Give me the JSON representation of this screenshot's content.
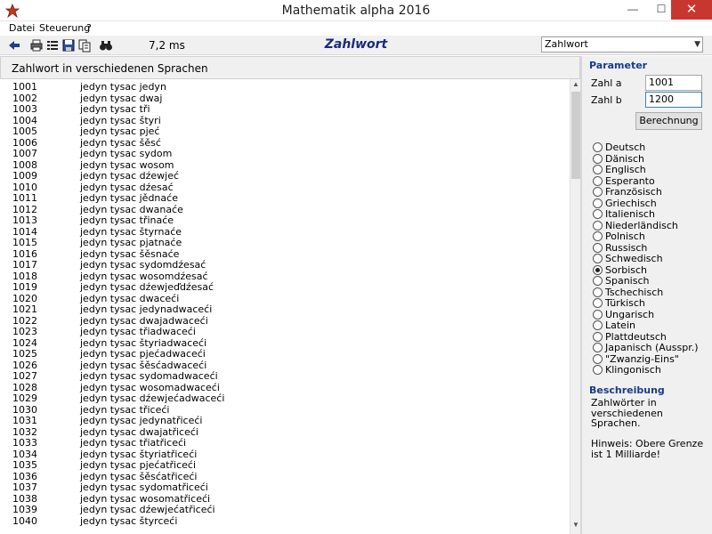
{
  "window": {
    "title": "Mathematik alpha 2016"
  },
  "menu": [
    {
      "label": "Datei",
      "accel": "D"
    },
    {
      "label": "Steuerung",
      "accel": "S"
    },
    {
      "label": "?"
    }
  ],
  "toolbar": {
    "timing": "7,2 ms",
    "title": "Zahlwort",
    "select_value": "Zahlwort"
  },
  "main": {
    "header": "Zahlwort in verschiedenen Sprachen",
    "rows": [
      {
        "num": "1001",
        "word": "jedyn tysac jedyn"
      },
      {
        "num": "1002",
        "word": "jedyn tysac dwaj"
      },
      {
        "num": "1003",
        "word": "jedyn tysac tři"
      },
      {
        "num": "1004",
        "word": "jedyn tysac štyri"
      },
      {
        "num": "1005",
        "word": "jedyn tysac pjeć"
      },
      {
        "num": "1006",
        "word": "jedyn tysac šěsć"
      },
      {
        "num": "1007",
        "word": "jedyn tysac sydom"
      },
      {
        "num": "1008",
        "word": "jedyn tysac wosom"
      },
      {
        "num": "1009",
        "word": "jedyn tysac dźewjeć"
      },
      {
        "num": "1010",
        "word": "jedyn tysac dźesać"
      },
      {
        "num": "1011",
        "word": "jedyn tysac jědnaće"
      },
      {
        "num": "1012",
        "word": "jedyn tysac dwanaće"
      },
      {
        "num": "1013",
        "word": "jedyn tysac třinaće"
      },
      {
        "num": "1014",
        "word": "jedyn tysac štyrnaće"
      },
      {
        "num": "1015",
        "word": "jedyn tysac pjatnaće"
      },
      {
        "num": "1016",
        "word": "jedyn tysac šěsnaće"
      },
      {
        "num": "1017",
        "word": "jedyn tysac sydomdźesać"
      },
      {
        "num": "1018",
        "word": "jedyn tysac wosomdźesać"
      },
      {
        "num": "1019",
        "word": "jedyn tysac dźewjeďdźesać"
      },
      {
        "num": "1020",
        "word": "jedyn tysac dwaceći"
      },
      {
        "num": "1021",
        "word": "jedyn tysac jedynadwaceći"
      },
      {
        "num": "1022",
        "word": "jedyn tysac dwajadwaceći"
      },
      {
        "num": "1023",
        "word": "jedyn tysac třiadwaceći"
      },
      {
        "num": "1024",
        "word": "jedyn tysac štyriadwaceći"
      },
      {
        "num": "1025",
        "word": "jedyn tysac pjećadwaceći"
      },
      {
        "num": "1026",
        "word": "jedyn tysac šěsćadwaceći"
      },
      {
        "num": "1027",
        "word": "jedyn tysac sydomadwaceći"
      },
      {
        "num": "1028",
        "word": "jedyn tysac wosomadwaceći"
      },
      {
        "num": "1029",
        "word": "jedyn tysac dźewjećadwaceći"
      },
      {
        "num": "1030",
        "word": "jedyn tysac třiceći"
      },
      {
        "num": "1031",
        "word": "jedyn tysac jedynatřiceći"
      },
      {
        "num": "1032",
        "word": "jedyn tysac dwajatřiceći"
      },
      {
        "num": "1033",
        "word": "jedyn tysac třiatřiceći"
      },
      {
        "num": "1034",
        "word": "jedyn tysac štyriatřiceći"
      },
      {
        "num": "1035",
        "word": "jedyn tysac pjećatřiceći"
      },
      {
        "num": "1036",
        "word": "jedyn tysac šěsćatřiceći"
      },
      {
        "num": "1037",
        "word": "jedyn tysac sydomatřiceći"
      },
      {
        "num": "1038",
        "word": "jedyn tysac wosomatřiceći"
      },
      {
        "num": "1039",
        "word": "jedyn tysac dźewjećatřiceći"
      },
      {
        "num": "1040",
        "word": "jedyn tysac štyrceći"
      }
    ]
  },
  "side": {
    "parameter_title": "Parameter",
    "zahl_a_label": "Zahl a",
    "zahl_a_value": "1001",
    "zahl_b_label": "Zahl b",
    "zahl_b_value": "1200",
    "calc_label": "Berechnung",
    "languages": [
      {
        "label": "Deutsch",
        "selected": false
      },
      {
        "label": "Dänisch",
        "selected": false
      },
      {
        "label": "Englisch",
        "selected": false
      },
      {
        "label": "Esperanto",
        "selected": false
      },
      {
        "label": "Französisch",
        "selected": false
      },
      {
        "label": "Griechisch",
        "selected": false
      },
      {
        "label": "Italienisch",
        "selected": false
      },
      {
        "label": "Niederländisch",
        "selected": false
      },
      {
        "label": "Polnisch",
        "selected": false
      },
      {
        "label": "Russisch",
        "selected": false
      },
      {
        "label": "Schwedisch",
        "selected": false
      },
      {
        "label": "Sorbisch",
        "selected": true
      },
      {
        "label": "Spanisch",
        "selected": false
      },
      {
        "label": "Tschechisch",
        "selected": false
      },
      {
        "label": "Türkisch",
        "selected": false
      },
      {
        "label": "Ungarisch",
        "selected": false
      },
      {
        "label": "Latein",
        "selected": false
      },
      {
        "label": "Plattdeutsch",
        "selected": false
      },
      {
        "label": "Japanisch (Ausspr.)",
        "selected": false
      },
      {
        "label": "\"Zwanzig-Eins\"",
        "selected": false
      },
      {
        "label": "Klingonisch",
        "selected": false
      }
    ],
    "description_title": "Beschreibung",
    "description_lines": [
      "Zahlwörter in",
      "verschiedenen",
      "Sprachen.",
      "",
      "Hinweis: Obere Grenze",
      "ist 1 Milliarde!"
    ]
  },
  "icons": [
    "app-icon",
    "back-icon",
    "print-icon",
    "list-icon",
    "save-icon",
    "copy-icon",
    "binoculars-icon",
    "chevron-down-icon"
  ],
  "colors": {
    "heading": "#1a3a8a",
    "title_blue": "#1a2a7a",
    "close_red": "#c7372f"
  }
}
